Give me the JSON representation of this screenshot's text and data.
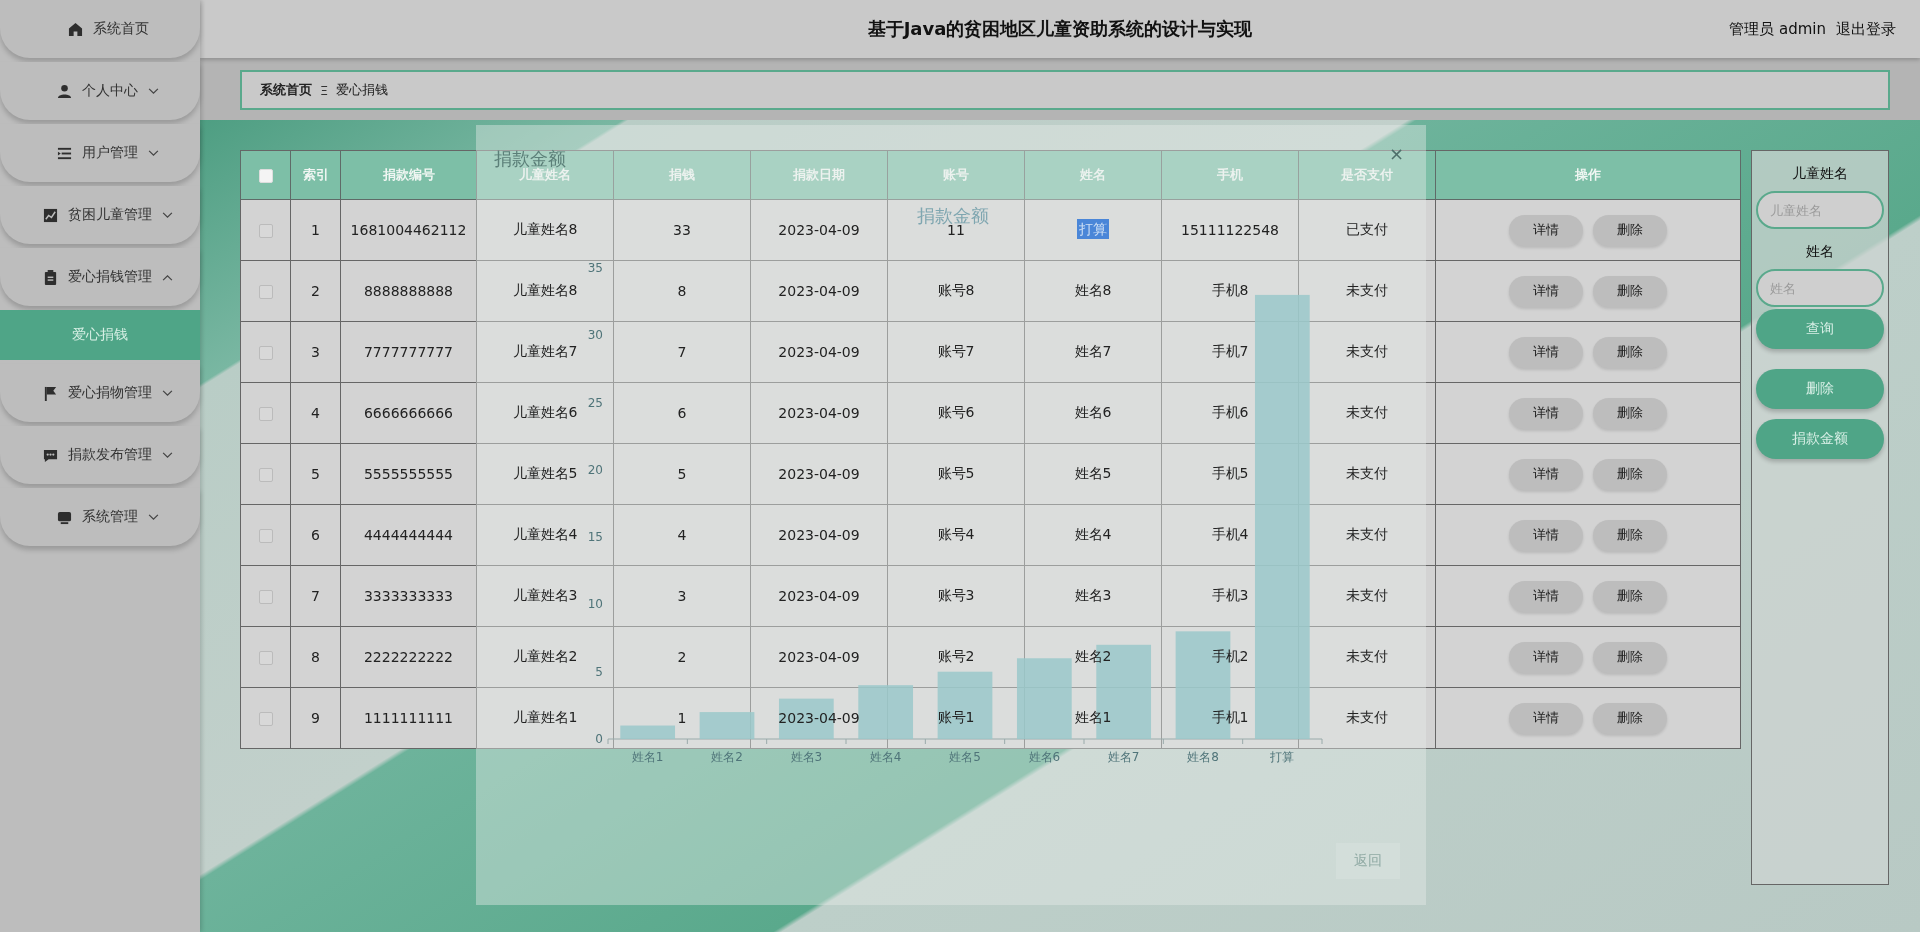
{
  "sidebar": {
    "items": [
      {
        "label": "系统首页"
      },
      {
        "label": "个人中心",
        "expanded": false
      },
      {
        "label": "用户管理",
        "expanded": false
      },
      {
        "label": "贫困儿童管理",
        "expanded": false
      },
      {
        "label": "爱心捐钱管理",
        "expanded": true,
        "children": [
          {
            "label": "爱心捐钱",
            "selected": true
          }
        ]
      },
      {
        "label": "爱心捐物管理",
        "expanded": false
      },
      {
        "label": "捐款发布管理",
        "expanded": false
      },
      {
        "label": "系统管理",
        "expanded": false
      }
    ]
  },
  "header": {
    "title": "基于Java的贫困地区儿童资助系统的设计与实现",
    "user": "管理员 admin",
    "logout": "退出登录"
  },
  "breadcrumb": {
    "items": [
      "系统首页",
      "爱心捐钱"
    ],
    "separator": "Ξ"
  },
  "table": {
    "select_all": {
      "checked": false
    },
    "columns": [
      "索引",
      "捐款编号",
      "儿童姓名",
      "捐钱",
      "捐款日期",
      "账号",
      "姓名",
      "手机",
      "是否支付",
      "操作"
    ],
    "rows": [
      {
        "checked": false,
        "name_highlighted": true,
        "cells": [
          "1",
          "1681004462112",
          "儿童姓名8",
          "33",
          "2023-04-09",
          "11",
          "打算",
          "15111122548",
          "已支付"
        ],
        "actions": [
          "详情",
          "删除"
        ]
      },
      {
        "checked": false,
        "name_highlighted": false,
        "cells": [
          "2",
          "8888888888",
          "儿童姓名8",
          "8",
          "2023-04-09",
          "账号8",
          "姓名8",
          "手机8",
          "未支付"
        ],
        "actions": [
          "详情",
          "删除"
        ]
      },
      {
        "checked": false,
        "name_highlighted": false,
        "cells": [
          "3",
          "7777777777",
          "儿童姓名7",
          "7",
          "2023-04-09",
          "账号7",
          "姓名7",
          "手机7",
          "未支付"
        ],
        "actions": [
          "详情",
          "删除"
        ]
      },
      {
        "checked": false,
        "name_highlighted": false,
        "cells": [
          "4",
          "6666666666",
          "儿童姓名6",
          "6",
          "2023-04-09",
          "账号6",
          "姓名6",
          "手机6",
          "未支付"
        ],
        "actions": [
          "详情",
          "删除"
        ]
      },
      {
        "checked": false,
        "name_highlighted": false,
        "cells": [
          "5",
          "5555555555",
          "儿童姓名5",
          "5",
          "2023-04-09",
          "账号5",
          "姓名5",
          "手机5",
          "未支付"
        ],
        "actions": [
          "详情",
          "删除"
        ]
      },
      {
        "checked": false,
        "name_highlighted": false,
        "cells": [
          "6",
          "4444444444",
          "儿童姓名4",
          "4",
          "2023-04-09",
          "账号4",
          "姓名4",
          "手机4",
          "未支付"
        ],
        "actions": [
          "详情",
          "删除"
        ]
      },
      {
        "checked": false,
        "name_highlighted": false,
        "cells": [
          "7",
          "3333333333",
          "儿童姓名3",
          "3",
          "2023-04-09",
          "账号3",
          "姓名3",
          "手机3",
          "未支付"
        ],
        "actions": [
          "详情",
          "删除"
        ]
      },
      {
        "checked": false,
        "name_highlighted": false,
        "cells": [
          "8",
          "2222222222",
          "儿童姓名2",
          "2",
          "2023-04-09",
          "账号2",
          "姓名2",
          "手机2",
          "未支付"
        ],
        "actions": [
          "详情",
          "删除"
        ]
      },
      {
        "checked": false,
        "name_highlighted": false,
        "cells": [
          "9",
          "1111111111",
          "儿童姓名1",
          "1",
          "2023-04-09",
          "账号1",
          "姓名1",
          "手机1",
          "未支付"
        ],
        "actions": [
          "详情",
          "删除"
        ]
      }
    ]
  },
  "search_panel": {
    "fields": [
      {
        "label": "儿童姓名",
        "placeholder": "儿童姓名"
      },
      {
        "label": "姓名",
        "placeholder": "姓名"
      }
    ],
    "search_button": "查询",
    "buttons": [
      "删除",
      "捐款金额"
    ]
  },
  "modal": {
    "title": "捐款金额",
    "close": "×",
    "button": "返回",
    "chart_data": {
      "type": "bar",
      "title": "捐款金额",
      "categories": [
        "姓名1",
        "姓名2",
        "姓名3",
        "姓名4",
        "姓名5",
        "姓名6",
        "姓名7",
        "姓名8",
        "打算"
      ],
      "series": [
        {
          "color": "#9ac8ca",
          "values": [
            1,
            2,
            3,
            4,
            5,
            6,
            7,
            8,
            33
          ]
        }
      ],
      "ylim": [
        0,
        35
      ],
      "yticks": [
        0,
        5,
        10,
        15,
        20,
        25,
        30,
        35
      ]
    }
  }
}
